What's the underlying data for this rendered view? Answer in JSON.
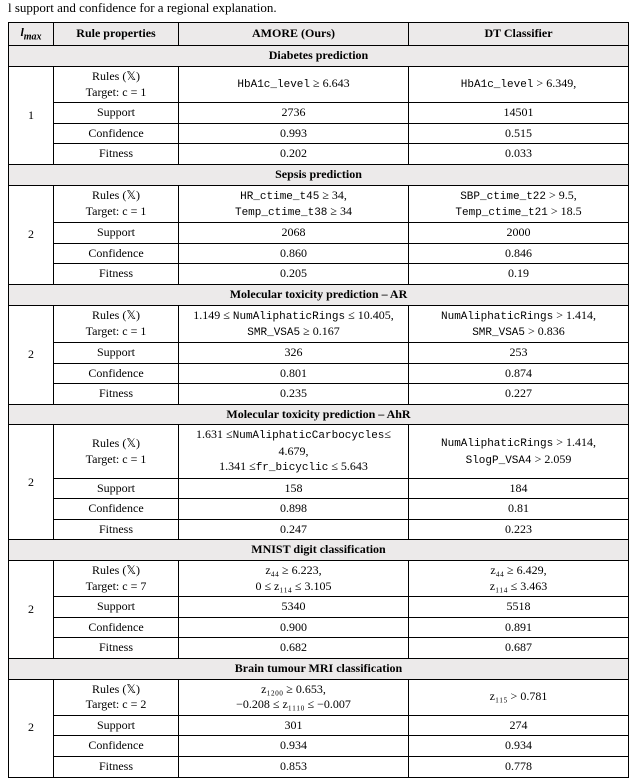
{
  "head_text": "l support and confidence for a regional explanation.",
  "headers": {
    "lmax": "l",
    "lmax_sub": "max",
    "ruleprops": "Rule properties",
    "amore": "AMORE (Ours)",
    "dt": "DT Classifier"
  },
  "labels": {
    "rules_line1": "Rules (𝕏)",
    "rules_line2_c1": "Target: c = 1",
    "rules_line2_c7": "Target: c = 7",
    "rules_line2_c2": "Target: c = 2",
    "support": "Support",
    "confidence": "Confidence",
    "fitness": "Fitness"
  },
  "sections": [
    {
      "title": "Diabetes prediction",
      "lmax": "1",
      "target": "rules_line2_c1",
      "rules_amore": "HbA1c_level ≥ 6.643",
      "rules_dt": "HbA1c_level > 6.349,",
      "support": [
        "2736",
        "14501"
      ],
      "confidence": [
        "0.993",
        "0.515"
      ],
      "fitness": [
        "0.202",
        "0.033"
      ]
    },
    {
      "title": "Sepsis prediction",
      "lmax": "2",
      "target": "rules_line2_c1",
      "rules_amore": "HR_ctime_t45 ≥ 34,\nTemp_ctime_t38 ≥ 34",
      "rules_dt": "SBP_ctime_t22 > 9.5,\nTemp_ctime_t21 > 18.5",
      "support": [
        "2068",
        "2000"
      ],
      "confidence": [
        "0.860",
        "0.846"
      ],
      "fitness": [
        "0.205",
        "0.19"
      ]
    },
    {
      "title": "Molecular toxicity prediction – AR",
      "lmax": "2",
      "target": "rules_line2_c1",
      "rules_amore": "1.149 ≤ NumAliphaticRings ≤ 10.405,\nSMR_VSA5 ≥ 0.167",
      "rules_dt": "NumAliphaticRings > 1.414,\nSMR_VSA5 > 0.836",
      "support": [
        "326",
        "253"
      ],
      "confidence": [
        "0.801",
        "0.874"
      ],
      "fitness": [
        "0.235",
        "0.227"
      ]
    },
    {
      "title": "Molecular toxicity prediction – AhR",
      "lmax": "2",
      "target": "rules_line2_c1",
      "rules_amore": "1.631 ≤NumAliphaticCarbocycles≤ 4.679,\n1.341 ≤fr_bicyclic ≤ 5.643",
      "rules_dt": "NumAliphaticRings > 1.414,\nSlogP_VSA4 > 2.059",
      "support": [
        "158",
        "184"
      ],
      "confidence": [
        "0.898",
        "0.81"
      ],
      "fitness": [
        "0.247",
        "0.223"
      ]
    },
    {
      "title": "MNIST digit classification",
      "lmax": "2",
      "target": "rules_line2_c7",
      "rules_amore": "z₄₄ ≥ 6.223,\n0 ≤ z₁₁₄ ≤ 3.105",
      "rules_dt": "z₄₄ ≥ 6.429,\nz₁₁₄ ≤ 3.463",
      "support": [
        "5340",
        "5518"
      ],
      "confidence": [
        "0.900",
        "0.891"
      ],
      "fitness": [
        "0.682",
        "0.687"
      ]
    },
    {
      "title": "Brain tumour MRI classification",
      "lmax": "2",
      "target": "rules_line2_c2",
      "rules_amore": "z₁₂₀₀ ≥ 0.653,\n−0.208 ≤ z₁₁₁₀ ≤ −0.007",
      "rules_dt": "z₁₁₅ > 0.781",
      "support": [
        "301",
        "274"
      ],
      "confidence": [
        "0.934",
        "0.934"
      ],
      "fitness": [
        "0.853",
        "0.778"
      ]
    }
  ]
}
